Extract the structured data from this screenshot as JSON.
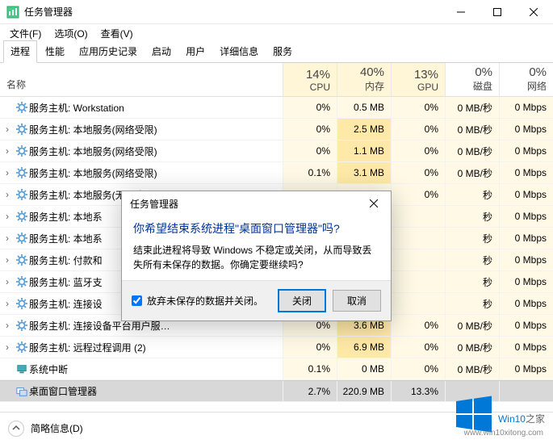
{
  "window": {
    "title": "任务管理器",
    "min": "–",
    "max": "□",
    "close": "×"
  },
  "menu": {
    "file": "文件(F)",
    "options": "选项(O)",
    "view": "查看(V)"
  },
  "tabs": [
    "进程",
    "性能",
    "应用历史记录",
    "启动",
    "用户",
    "详细信息",
    "服务"
  ],
  "activeTab": 0,
  "columns": {
    "name": "名称",
    "cpu": {
      "pct": "14%",
      "label": "CPU"
    },
    "mem": {
      "pct": "40%",
      "label": "内存"
    },
    "gpu": {
      "pct": "13%",
      "label": "GPU"
    },
    "disk": {
      "pct": "0%",
      "label": "磁盘"
    },
    "net": {
      "pct": "0%",
      "label": "网络"
    }
  },
  "rows": [
    {
      "exp": "",
      "name": "服务主机: Workstation",
      "cpu": "0%",
      "mem": "0.5 MB",
      "gpu": "0%",
      "disk": "0 MB/秒",
      "net": "0 Mbps",
      "heat": [
        "h0",
        "h0",
        "h0",
        "h0",
        "h0"
      ]
    },
    {
      "exp": "›",
      "name": "服务主机: 本地服务(网络受限)",
      "cpu": "0%",
      "mem": "2.5 MB",
      "gpu": "0%",
      "disk": "0 MB/秒",
      "net": "0 Mbps",
      "heat": [
        "h0",
        "h1",
        "h0",
        "h0",
        "h0"
      ]
    },
    {
      "exp": "›",
      "name": "服务主机: 本地服务(网络受限)",
      "cpu": "0%",
      "mem": "1.1 MB",
      "gpu": "0%",
      "disk": "0 MB/秒",
      "net": "0 Mbps",
      "heat": [
        "h0",
        "h1",
        "h0",
        "h0",
        "h0"
      ]
    },
    {
      "exp": "›",
      "name": "服务主机: 本地服务(网络受限)",
      "cpu": "0.1%",
      "mem": "3.1 MB",
      "gpu": "0%",
      "disk": "0 MB/秒",
      "net": "0 Mbps",
      "heat": [
        "h0",
        "h1",
        "h0",
        "h0",
        "h0"
      ]
    },
    {
      "exp": "›",
      "name": "服务主机: 本地服务(无网络)",
      "cpu": "0%",
      "mem": "",
      "gpu": "0%",
      "disk": "秒",
      "net": "0 Mbps",
      "heat": [
        "h0",
        "h0",
        "h0",
        "h0",
        "h0"
      ]
    },
    {
      "exp": "›",
      "name": "服务主机: 本地系",
      "cpu": "",
      "mem": "",
      "gpu": "",
      "disk": "秒",
      "net": "0 Mbps",
      "heat": [
        "h0",
        "h0",
        "h0",
        "h0",
        "h0"
      ]
    },
    {
      "exp": "›",
      "name": "服务主机: 本地系",
      "cpu": "",
      "mem": "",
      "gpu": "",
      "disk": "秒",
      "net": "0 Mbps",
      "heat": [
        "h0",
        "h0",
        "h0",
        "h0",
        "h0"
      ]
    },
    {
      "exp": "›",
      "name": "服务主机: 付款和",
      "cpu": "",
      "mem": "",
      "gpu": "",
      "disk": "秒",
      "net": "0 Mbps",
      "heat": [
        "h0",
        "h0",
        "h0",
        "h0",
        "h0"
      ]
    },
    {
      "exp": "›",
      "name": "服务主机: 蓝牙支",
      "cpu": "",
      "mem": "",
      "gpu": "",
      "disk": "秒",
      "net": "0 Mbps",
      "heat": [
        "h0",
        "h0",
        "h0",
        "h0",
        "h0"
      ]
    },
    {
      "exp": "›",
      "name": "服务主机: 连接设",
      "cpu": "",
      "mem": "",
      "gpu": "",
      "disk": "秒",
      "net": "0 Mbps",
      "heat": [
        "h0",
        "h0",
        "h0",
        "h0",
        "h0"
      ]
    },
    {
      "exp": "›",
      "name": "服务主机: 连接设备平台用户服…",
      "cpu": "0%",
      "mem": "3.6 MB",
      "gpu": "0%",
      "disk": "0 MB/秒",
      "net": "0 Mbps",
      "heat": [
        "h0",
        "h1",
        "h0",
        "h0",
        "h0"
      ]
    },
    {
      "exp": "›",
      "name": "服务主机: 远程过程调用 (2)",
      "cpu": "0%",
      "mem": "6.9 MB",
      "gpu": "0%",
      "disk": "0 MB/秒",
      "net": "0 Mbps",
      "heat": [
        "h0",
        "h1",
        "h0",
        "h0",
        "h0"
      ]
    },
    {
      "exp": "",
      "name": "系统中断",
      "cpu": "0.1%",
      "mem": "0 MB",
      "gpu": "0%",
      "disk": "0 MB/秒",
      "net": "0 Mbps",
      "heat": [
        "h0",
        "h0",
        "h0",
        "h0",
        "h0"
      ],
      "icon": "sys"
    },
    {
      "exp": "",
      "name": "桌面窗口管理器",
      "cpu": "2.7%",
      "mem": "220.9 MB",
      "gpu": "13.3%",
      "disk": "",
      "net": "",
      "heat": [
        "",
        "",
        "",
        "",
        ""
      ],
      "sel": true,
      "last": true,
      "icon": "dwm"
    }
  ],
  "footer": {
    "label": "简略信息(D)"
  },
  "dialog": {
    "title": "任务管理器",
    "heading": "你希望结束系统进程\"桌面窗口管理器\"吗?",
    "message": "结束此进程将导致 Windows 不稳定或关闭，从而导致丢失所有未保存的数据。你确定要继续吗?",
    "checkbox": "放弃未保存的数据并关闭。",
    "btn_close": "关闭",
    "btn_cancel": "取消"
  },
  "watermark": {
    "brand": "Win10",
    "suffix": "之家",
    "url": "www.win10xitong.com"
  }
}
